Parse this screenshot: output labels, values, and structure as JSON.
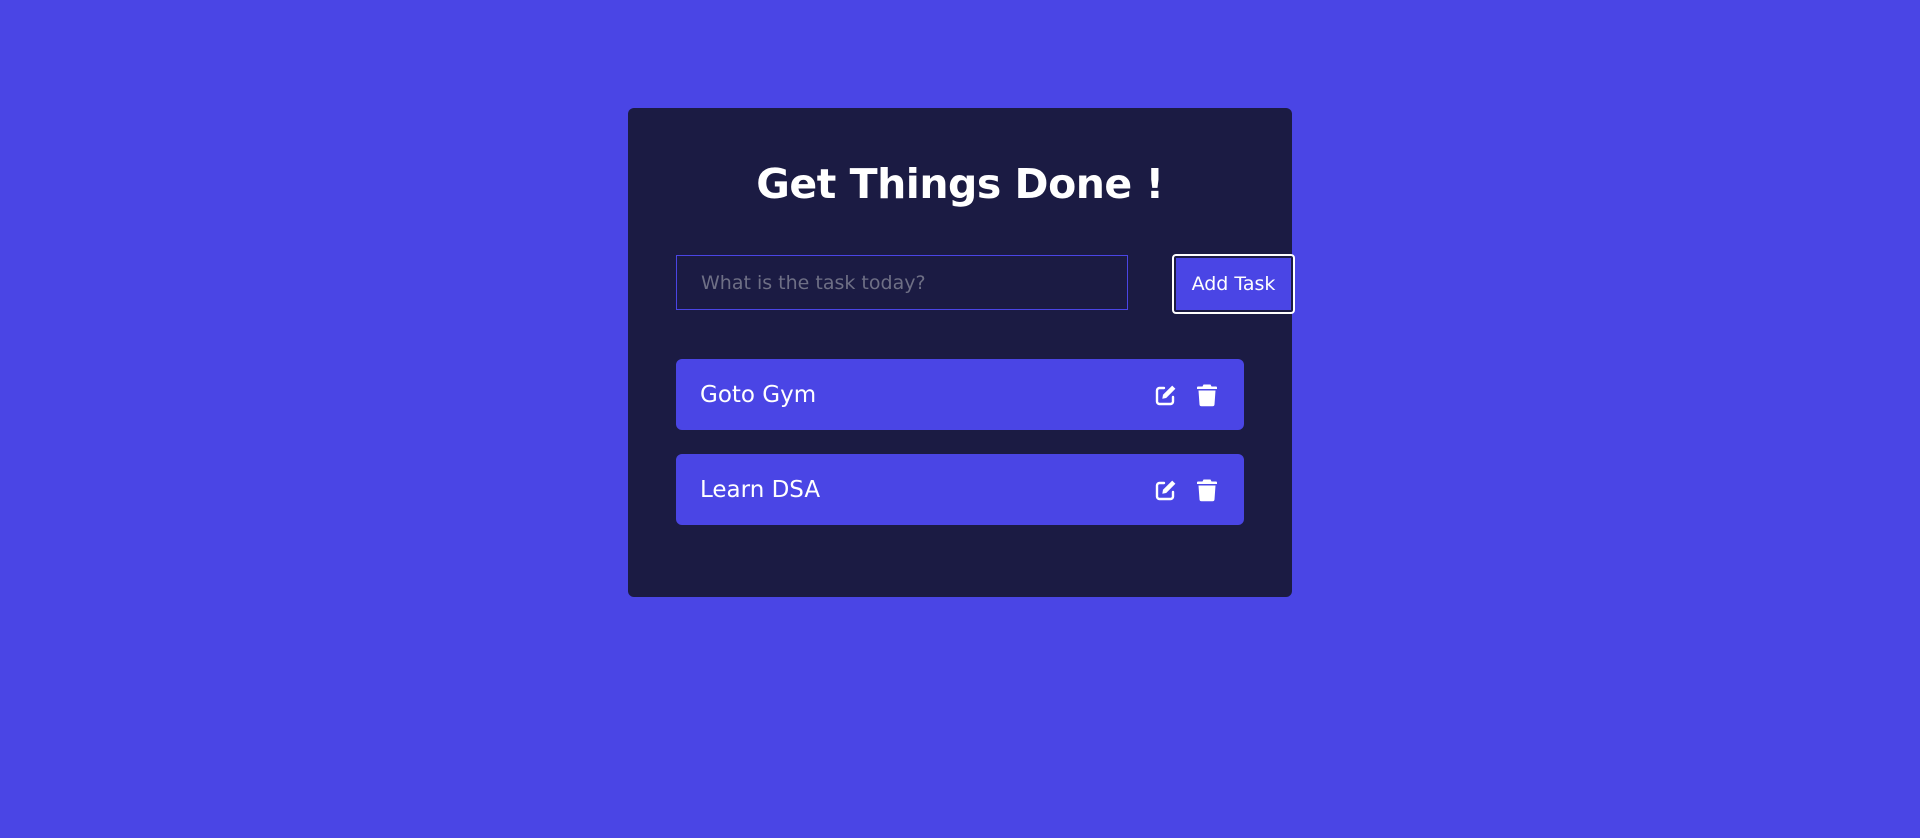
{
  "app": {
    "title": "Get Things Done !"
  },
  "form": {
    "input_value": "",
    "input_placeholder": "What is the task today?",
    "add_button_label": "Add Task"
  },
  "tasks": [
    {
      "label": "Goto Gym",
      "edit_icon": "edit-icon",
      "delete_icon": "trash-icon"
    },
    {
      "label": "Learn DSA",
      "edit_icon": "edit-icon",
      "delete_icon": "trash-icon"
    }
  ],
  "colors": {
    "background": "#4a45e5",
    "card": "#1b1b43",
    "task_item": "#4a45e5",
    "text": "#ffffff",
    "placeholder": "#6e6f85"
  }
}
